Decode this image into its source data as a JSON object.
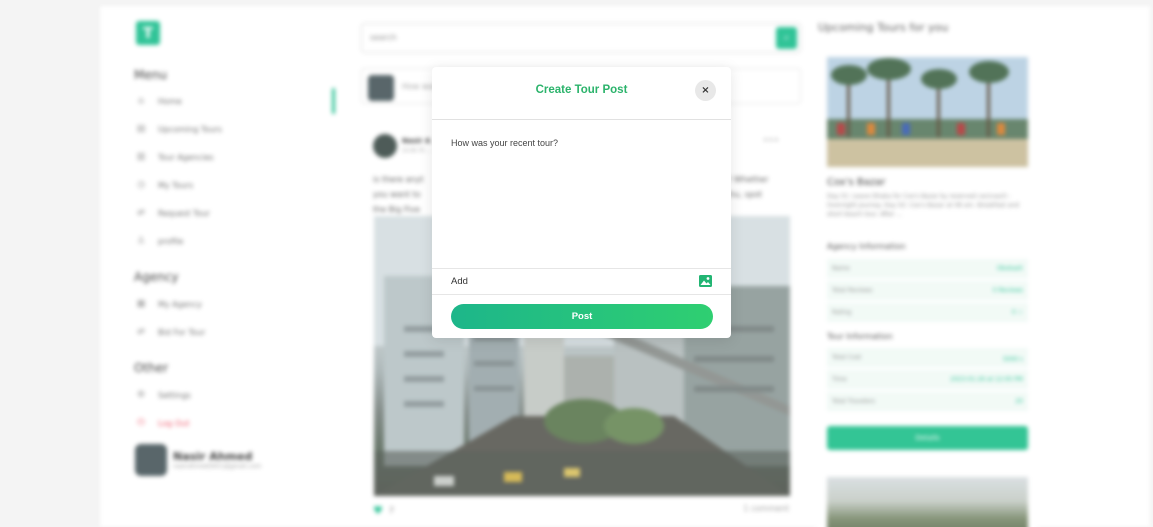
{
  "sidebar": {
    "logo": "T",
    "menu_title": "Menu",
    "menu_items": [
      {
        "label": "Home",
        "icon": "home-icon",
        "glyph": "⌂"
      },
      {
        "label": "Upcoming Tours",
        "icon": "calendar-icon",
        "glyph": "▤"
      },
      {
        "label": "Tour Agencies",
        "icon": "building-icon",
        "glyph": "▥"
      },
      {
        "label": "My Tours",
        "icon": "clock-icon",
        "glyph": "◷"
      },
      {
        "label": "Request Tour",
        "icon": "route-icon",
        "glyph": "⇄"
      },
      {
        "label": "profile",
        "icon": "user-icon",
        "glyph": "♙"
      }
    ],
    "agency_title": "Agency",
    "agency_items": [
      {
        "label": "My Agency",
        "icon": "briefcase-icon",
        "glyph": "▦"
      },
      {
        "label": "Bid For Tour",
        "icon": "route-icon",
        "glyph": "⇄"
      }
    ],
    "other_title": "Other",
    "other_items": [
      {
        "label": "Settings",
        "icon": "gear-icon",
        "glyph": "⚙"
      },
      {
        "label": "Log Out",
        "icon": "logout-icon",
        "glyph": "⏻"
      }
    ],
    "user": {
      "name": "Nasir Ahmed",
      "email": "nasirahmed2651@gmail.com"
    }
  },
  "feed": {
    "search_placeholder": "search",
    "compose_placeholder": "How was",
    "post": {
      "author": "Nasir A",
      "date": "14.06.76 ...",
      "text_left": "is there anyt\nyou want to\nthe Big Five",
      "text_right": "r! Whether\nchu, spot",
      "likes": "7",
      "comments": "1 comment"
    }
  },
  "right": {
    "title": "Upcoming Tours for you",
    "tour": {
      "name": "Cox's Bazar",
      "description": "Day 01: Leave Dhaka for Cox's Bazar by reserved car/coach - Overnight journey. Day 02: Cox's Bazar at 08 am. Breakfast and short beach tour. After ...",
      "agency_title": "Agency Information",
      "agency_rows": [
        {
          "label": "Name",
          "value": "Obokash"
        },
        {
          "label": "Total Reviews",
          "value": "0 Reviews"
        },
        {
          "label": "Rating",
          "value": "0 ☆"
        }
      ],
      "tour_title": "Tour Information",
      "tour_rows": [
        {
          "label": "Total Cost",
          "value": "5000 ৳"
        },
        {
          "label": "Time",
          "value": "2023-01-26 at 12:00 PM"
        },
        {
          "label": "Total Travelers",
          "value": "20"
        }
      ],
      "details_label": "Details"
    }
  },
  "modal": {
    "title": "Create Tour Post",
    "close_glyph": "×",
    "textarea_placeholder": "How was your recent tour?",
    "add_label": "Add",
    "post_label": "Post"
  },
  "colors": {
    "accent": "#1fbf8f",
    "title_green": "#2bb36b",
    "logout": "#ef4d61"
  }
}
